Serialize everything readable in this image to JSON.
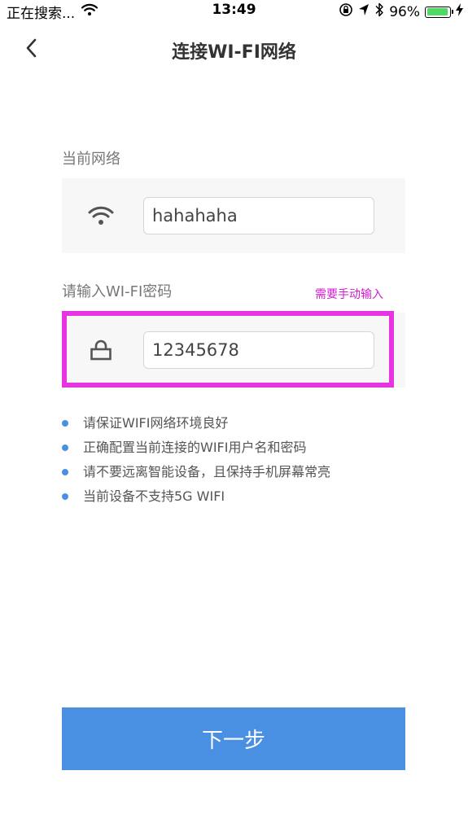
{
  "status_bar": {
    "carrier_text": "正在搜索...",
    "time": "13:49",
    "battery_percent": "96%",
    "battery_level": 0.96,
    "battery_color": "#4cd964",
    "icons": [
      "wifi-icon",
      "rotation-lock-icon",
      "location-arrow-icon",
      "bluetooth-icon",
      "battery-icon",
      "charging-icon"
    ]
  },
  "nav": {
    "title": "连接WI-FI网络",
    "back_icon": "chevron-left-icon"
  },
  "network_section": {
    "label": "当前网络",
    "icon": "wifi-icon",
    "value": "hahahaha"
  },
  "password_section": {
    "label": "请输入WI-FI密码",
    "icon": "lock-icon",
    "value": "12345678",
    "annotation": "需要手动输入",
    "highlight_color": "#e733e0"
  },
  "tips": [
    "请保证WIFI网络环境良好",
    "正确配置当前连接的WIFI用户名和密码",
    "请不要远离智能设备，且保持手机屏幕常亮",
    "当前设备不支持5G WIFI"
  ],
  "next_button": {
    "label": "下一步",
    "color": "#4a90e2"
  }
}
